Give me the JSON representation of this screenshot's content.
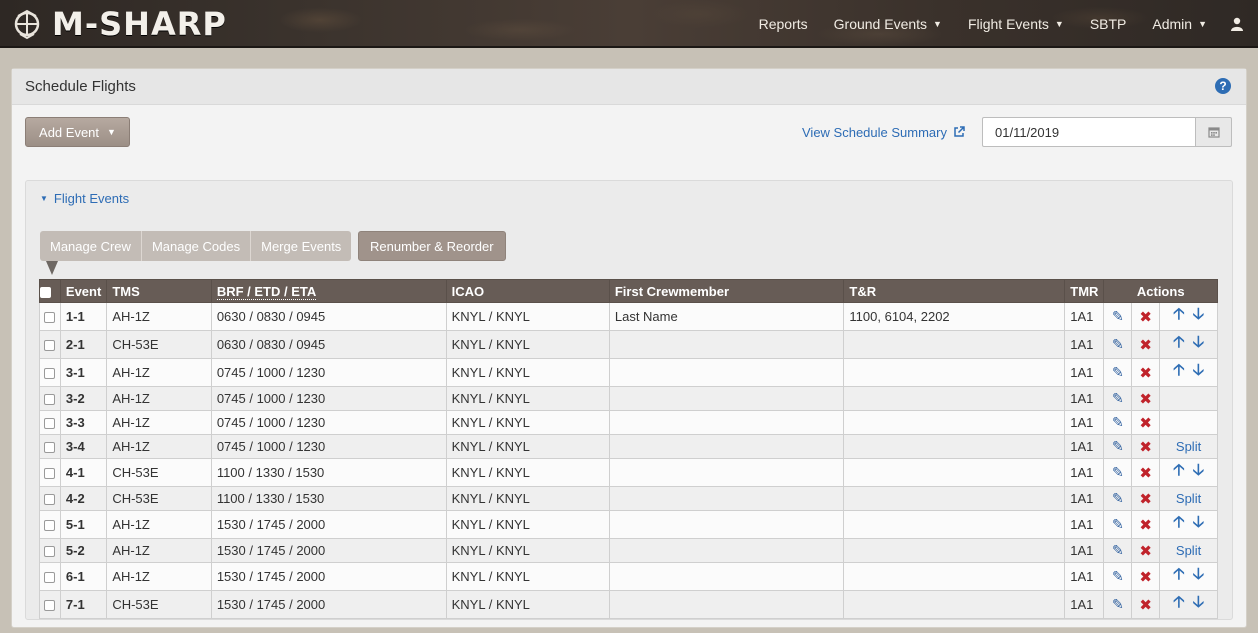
{
  "app": {
    "brand": "M-SHARP"
  },
  "nav": {
    "items": [
      {
        "label": "Reports",
        "has_caret": false
      },
      {
        "label": "Ground Events",
        "has_caret": true
      },
      {
        "label": "Flight Events",
        "has_caret": true
      },
      {
        "label": "SBTP",
        "has_caret": false
      },
      {
        "label": "Admin",
        "has_caret": true
      }
    ],
    "user_icon": "user-icon"
  },
  "page": {
    "title": "Schedule Flights",
    "help_icon": "question-circle-icon",
    "add_event_label": "Add Event",
    "view_summary_label": "View Schedule Summary",
    "date_value": "01/11/2019",
    "calendar_icon": "calendar-icon"
  },
  "section": {
    "toggle_label": "Flight Events",
    "buttons": {
      "manage_crew": "Manage Crew",
      "manage_codes": "Manage Codes",
      "merge_events": "Merge Events",
      "renumber": "Renumber & Reorder"
    }
  },
  "table": {
    "headers": {
      "event": "Event",
      "tms": "TMS",
      "times": "BRF / ETD / ETA",
      "icao": "ICAO",
      "crew": "First Crewmember",
      "tr": "T&R",
      "tmr": "TMR",
      "actions": "Actions"
    },
    "split_label": "Split",
    "rows": [
      {
        "event": "1-1",
        "tms": "AH-1Z",
        "times": "0630 / 0830 / 0945",
        "icao": "KNYL / KNYL",
        "crew": "Last Name",
        "tr": "1100, 6104, 2202",
        "tmr": "1A1",
        "move": "arrows"
      },
      {
        "event": "2-1",
        "tms": "CH-53E",
        "times": "0630 / 0830 / 0945",
        "icao": "KNYL / KNYL",
        "crew": "",
        "tr": "",
        "tmr": "1A1",
        "move": "arrows"
      },
      {
        "event": "3-1",
        "tms": "AH-1Z",
        "times": "0745 / 1000 / 1230",
        "icao": "KNYL / KNYL",
        "crew": "",
        "tr": "",
        "tmr": "1A1",
        "move": "arrows"
      },
      {
        "event": "3-2",
        "tms": "AH-1Z",
        "times": "0745 / 1000 / 1230",
        "icao": "KNYL / KNYL",
        "crew": "",
        "tr": "",
        "tmr": "1A1",
        "move": ""
      },
      {
        "event": "3-3",
        "tms": "AH-1Z",
        "times": "0745 / 1000 / 1230",
        "icao": "KNYL / KNYL",
        "crew": "",
        "tr": "",
        "tmr": "1A1",
        "move": ""
      },
      {
        "event": "3-4",
        "tms": "AH-1Z",
        "times": "0745 / 1000 / 1230",
        "icao": "KNYL / KNYL",
        "crew": "",
        "tr": "",
        "tmr": "1A1",
        "move": "split"
      },
      {
        "event": "4-1",
        "tms": "CH-53E",
        "times": "1100 / 1330 / 1530",
        "icao": "KNYL / KNYL",
        "crew": "",
        "tr": "",
        "tmr": "1A1",
        "move": "arrows"
      },
      {
        "event": "4-2",
        "tms": "CH-53E",
        "times": "1100 / 1330 / 1530",
        "icao": "KNYL / KNYL",
        "crew": "",
        "tr": "",
        "tmr": "1A1",
        "move": "split"
      },
      {
        "event": "5-1",
        "tms": "AH-1Z",
        "times": "1530 / 1745 / 2000",
        "icao": "KNYL / KNYL",
        "crew": "",
        "tr": "",
        "tmr": "1A1",
        "move": "arrows"
      },
      {
        "event": "5-2",
        "tms": "AH-1Z",
        "times": "1530 / 1745 / 2000",
        "icao": "KNYL / KNYL",
        "crew": "",
        "tr": "",
        "tmr": "1A1",
        "move": "split"
      },
      {
        "event": "6-1",
        "tms": "AH-1Z",
        "times": "1530 / 1745 / 2000",
        "icao": "KNYL / KNYL",
        "crew": "",
        "tr": "",
        "tmr": "1A1",
        "move": "arrows"
      },
      {
        "event": "7-1",
        "tms": "CH-53E",
        "times": "1530 / 1745 / 2000",
        "icao": "KNYL / KNYL",
        "crew": "",
        "tr": "",
        "tmr": "1A1",
        "move": "arrows"
      }
    ]
  }
}
